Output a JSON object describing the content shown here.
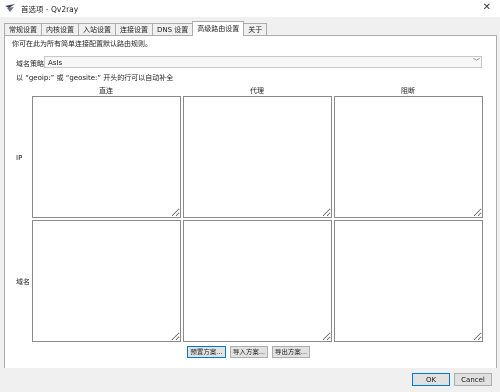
{
  "window": {
    "title": "首选项 - Qv2ray"
  },
  "tabs": [
    "常规设置",
    "内核设置",
    "入站设置",
    "连接设置",
    "DNS 设置",
    "高级路由设置",
    "关于"
  ],
  "active_tab": 5,
  "hint_top": "你可在此为所有简单连接配置默认路由规则。",
  "domain_strategy": {
    "label": "域名策略",
    "value": "AsIs"
  },
  "hint_geo": "以 “geoip:” 或 “geosite:” 开头的行可以自动补全",
  "columns": [
    "直连",
    "代理",
    "阻断"
  ],
  "rows": [
    "IP",
    "域名"
  ],
  "buttons": {
    "preset": "预置方案...",
    "import": "导入方案...",
    "export": "导出方案..."
  },
  "footer": {
    "ok": "OK",
    "cancel": "Cancel"
  },
  "icons": {
    "app": "qv2ray-logo-icon",
    "close": "close-icon",
    "dropdown": "chevron-down-icon"
  }
}
